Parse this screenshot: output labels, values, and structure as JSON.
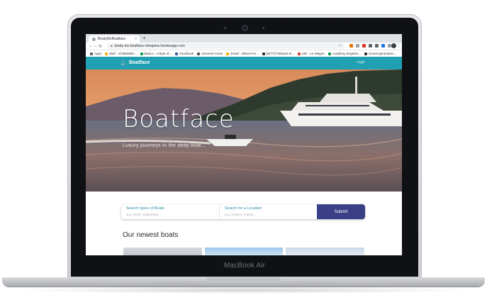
{
  "device": {
    "brand_label": "MacBook Air"
  },
  "browser": {
    "tab_title": "BoatyMcBoatface",
    "new_tab": "+",
    "tab_close": "×",
    "url": "boaty-mc-boatface-olivapore.herokuapp.com",
    "bookmarks": [
      {
        "label": "Apps",
        "color": "#5f6368"
      },
      {
        "label": "Mail - VCBE6893...",
        "color": "#f4b400"
      },
      {
        "label": "Basics - A Byte of...",
        "color": "#0f9d58"
      },
      {
        "label": "Facebook",
        "color": "#3b5998"
      },
      {
        "label": "General Forum",
        "color": "#555555"
      },
      {
        "label": "Email - Olivia Pon...",
        "color": "#f4b400"
      },
      {
        "label": "[W77] Fullstack B...",
        "color": "#333333"
      },
      {
        "label": "H/D - Le Wagon",
        "color": "#db4437"
      },
      {
        "label": "Academy Enginee...",
        "color": "#0f9d58"
      },
      {
        "label": "Sound generation...",
        "color": "#333333"
      }
    ],
    "extension_colors": [
      "#e37400",
      "#9aa0a6",
      "#d93025",
      "#5f6368",
      "#5f6368",
      "#1a73e8",
      "#9aa0a6"
    ]
  },
  "app": {
    "brand": "Boatface",
    "login": "Login",
    "hero": {
      "title": "Boatface",
      "subtitle": "Luxury journeys in the deep blue..."
    },
    "search": {
      "type_label": "Search types of Boats",
      "type_placeholder": "E.g. Yacht, Catamaran...",
      "location_label": "Search for a Location",
      "location_placeholder": "E.g. Greece, France...",
      "submit": "Submit"
    },
    "newest_heading": "Our newest boats"
  },
  "colors": {
    "nav_bar": "#1fa0b3",
    "submit_button": "#3a3f86",
    "search_label": "#2a8fa1"
  }
}
